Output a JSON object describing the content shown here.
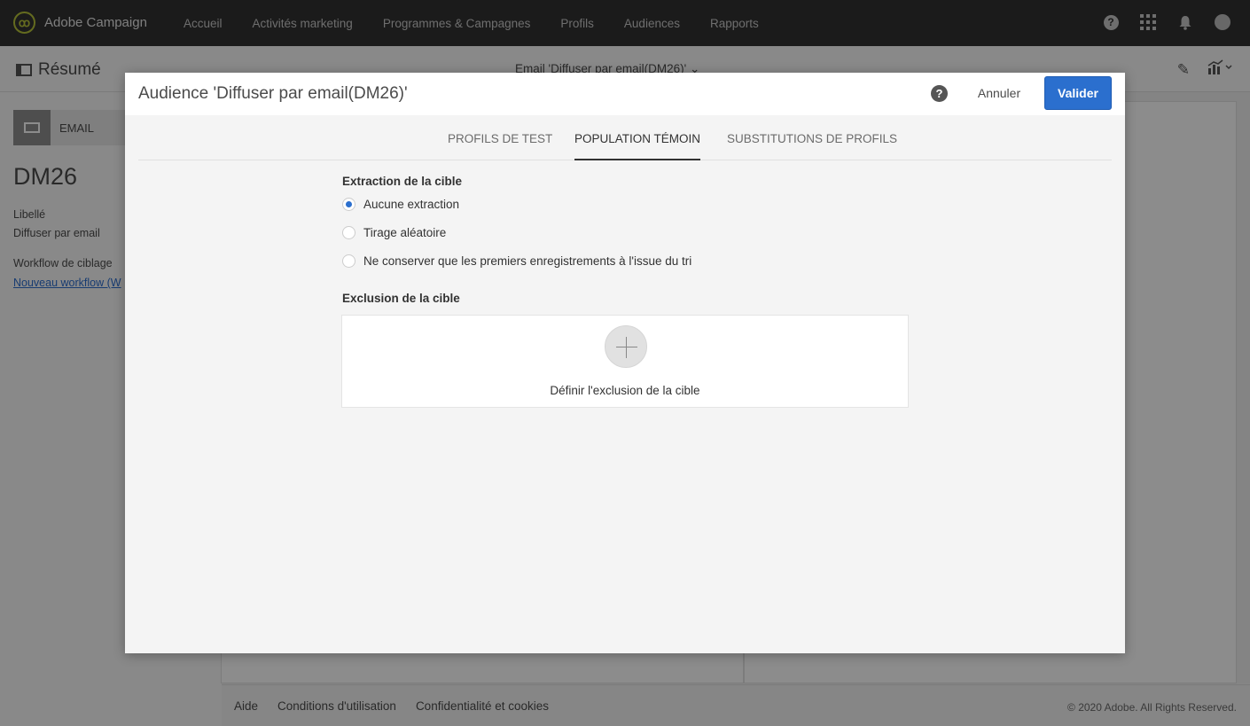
{
  "app": {
    "name": "Adobe Campaign",
    "nav": [
      "Accueil",
      "Activités marketing",
      "Programmes & Campagnes",
      "Profils",
      "Audiences",
      "Rapports"
    ]
  },
  "subheader": {
    "summary_title": "Résumé",
    "center_title": "Email 'Diffuser par email(DM26)' ⌄"
  },
  "left_panel": {
    "tab_label": "EMAIL",
    "title": "DM26",
    "label_caption": "Libellé",
    "label_value": "Diffuser par email",
    "workflow_caption": "Workflow de ciblage",
    "workflow_link": "Nouveau workflow (W"
  },
  "footer": {
    "links": [
      "Aide",
      "Conditions d'utilisation",
      "Confidentialité et cookies"
    ],
    "copyright": "© 2020 Adobe. All Rights Reserved."
  },
  "modal": {
    "title": "Audience 'Diffuser par email(DM26)'",
    "cancel_label": "Annuler",
    "validate_label": "Valider",
    "tabs": [
      "PROFILS DE TEST",
      "POPULATION TÉMOIN",
      "SUBSTITUTIONS DE PROFILS"
    ],
    "active_tab": "POPULATION TÉMOIN",
    "extraction": {
      "title": "Extraction de la cible",
      "options": [
        "Aucune extraction",
        "Tirage aléatoire",
        "Ne conserver que les premiers enregistrements à l'issue du tri"
      ],
      "selected": "Aucune extraction"
    },
    "exclusion": {
      "title": "Exclusion de la cible",
      "action_label": "Définir l'exclusion de la cible"
    }
  },
  "colors": {
    "topbar": "#323232",
    "accent": "#2b6fce",
    "logo": "#b6c33a"
  }
}
